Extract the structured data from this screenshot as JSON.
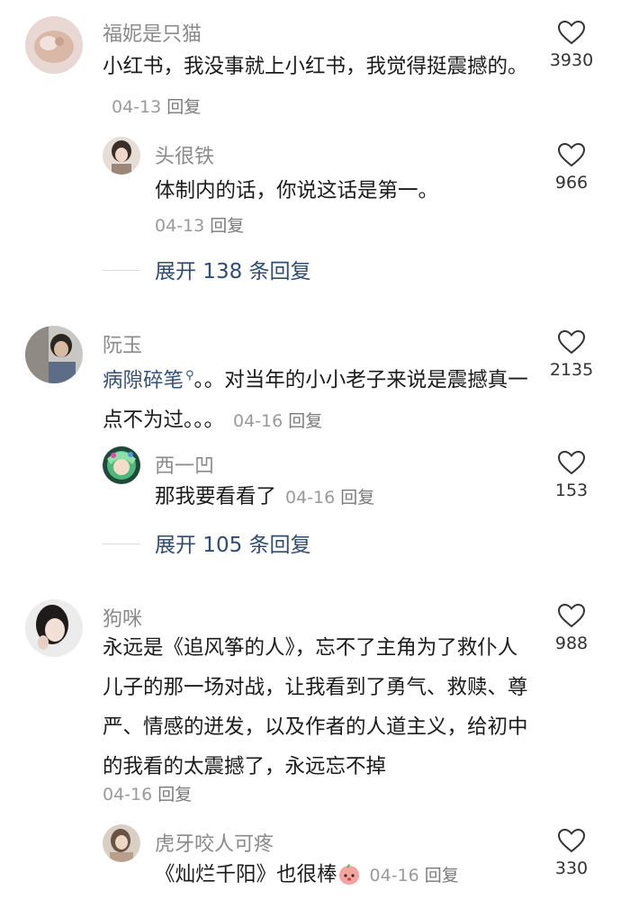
{
  "comments": [
    {
      "username": "福妮是只猫",
      "text": "小红书，我没事就上小红书，我觉得挺震撼的。",
      "date": "04-13",
      "reply_label": "回复",
      "likes": "3930",
      "reply": {
        "username": "头很铁",
        "text": "体制内的话，你说这话是第一。",
        "date": "04-13",
        "reply_label": "回复",
        "likes": "966"
      },
      "expand_label": "展开 138 条回复"
    },
    {
      "username": "阮玉",
      "mention": "病隙碎笔",
      "text": "。。对当年的小小老子来说是震撼真一点不为过。。。",
      "date": "04-16",
      "reply_label": "回复",
      "likes": "2135",
      "reply": {
        "username": "西一凹",
        "text": "那我要看看了",
        "date": "04-16",
        "reply_label": "回复",
        "likes": "153"
      },
      "expand_label": "展开 105 条回复"
    },
    {
      "username": "狗咪",
      "text": "永远是《追风筝的人》，忘不了主角为了救仆人儿子的那一场对战，让我看到了勇气、救赎、尊严、情感的迸发，以及作者的人道主义，给初中的我看的太震撼了，永远忘不掉",
      "date": "04-16",
      "reply_label": "回复",
      "likes": "988",
      "reply": {
        "username": "虎牙咬人可疼",
        "text": "《灿烂千阳》也很棒",
        "emoji": "peach-emoji",
        "date": "04-16",
        "reply_label": "回复",
        "likes": "330"
      }
    }
  ],
  "icons": {
    "like": "heart-outline-icon",
    "search": "search-icon"
  },
  "colors": {
    "link": "#2f4c72",
    "meta": "#9a9a9a",
    "username": "#8a8a8a"
  }
}
